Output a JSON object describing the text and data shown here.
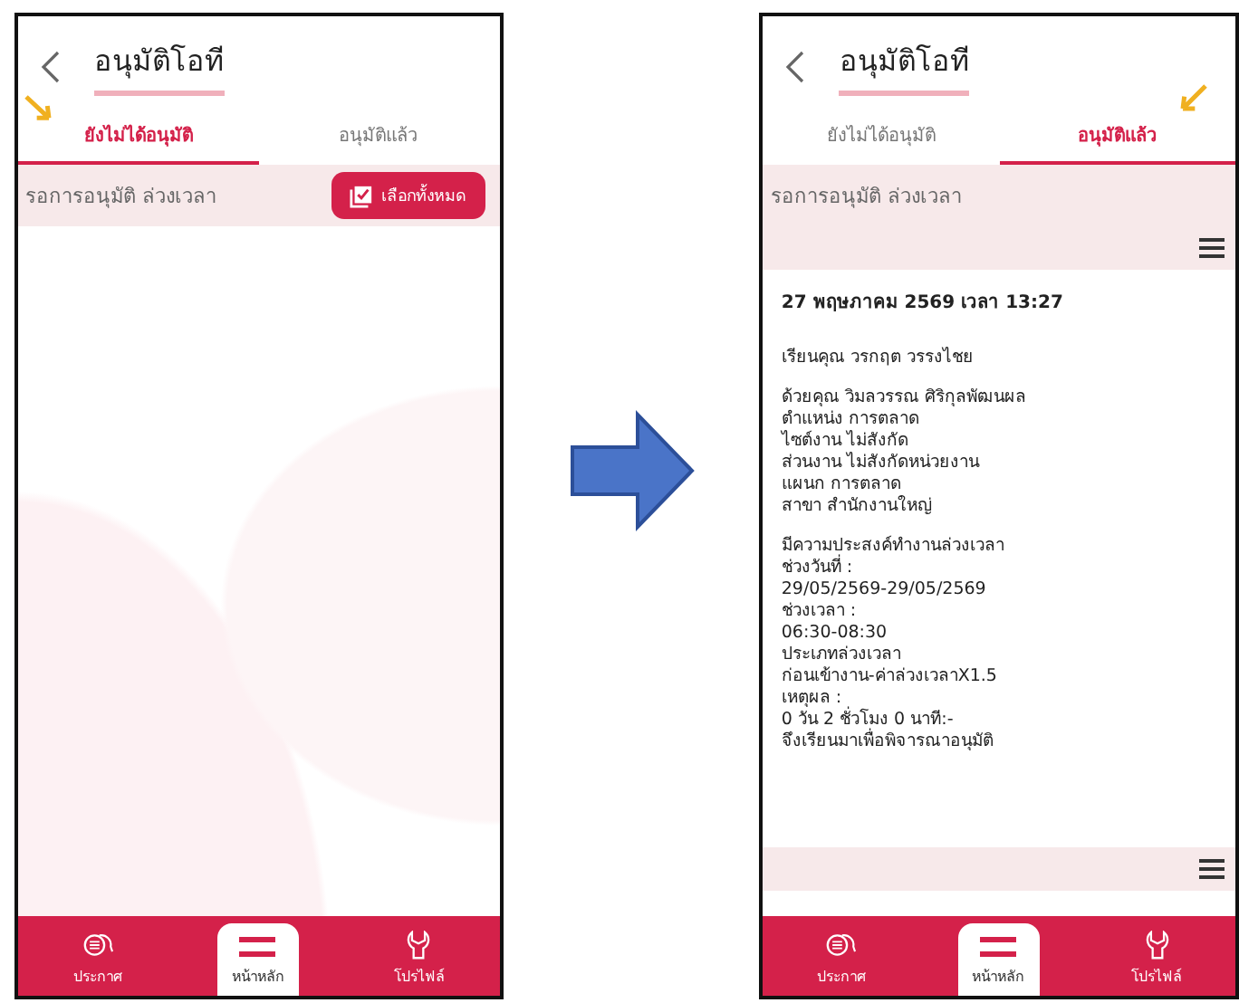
{
  "screens": [
    {
      "title": "อนุมัติโอที",
      "tabs": [
        {
          "label": "ยังไม่ได้อนุมัติ",
          "selected": true,
          "pointed": true
        },
        {
          "label": "อนุมัติแล้ว",
          "selected": false,
          "pointed": false
        }
      ],
      "subheader": "รอการอนุมัติ ล่วงเวลา",
      "select_all_button": "เลือกทั้งหมด",
      "nav": [
        {
          "label": "ประกาศ",
          "kind": "chat",
          "selected": false
        },
        {
          "label": "หน้าหลัก",
          "kind": "home",
          "selected": true
        },
        {
          "label": "โปรไฟล์",
          "kind": "tool",
          "selected": false
        }
      ]
    },
    {
      "title": "อนุมัติโอที",
      "tabs": [
        {
          "label": "ยังไม่ได้อนุมัติ",
          "selected": false,
          "pointed": false
        },
        {
          "label": "อนุมัติแล้ว",
          "selected": true,
          "pointed": true
        }
      ],
      "subheader": "รอการอนุมัติ ล่วงเวลา",
      "message": {
        "date": "27 พฤษภาคม 2569 เวลา 13:27",
        "paragraphs": [
          [
            "เรียนคุณ วรกฤต วรรงไชย"
          ],
          [
            "ด้วยคุณ วิมลวรรณ ศิริกุลพัฒนผล",
            "ตำแหน่ง การตลาด",
            "ไซต์งาน ไม่สังกัด",
            "ส่วนงาน ไม่สังกัดหน่วยงาน",
            "แผนก การตลาด",
            "สาขา สำนักงานใหญ่"
          ],
          [
            "มีความประสงค์ทำงานล่วงเวลา",
            "ช่วงวันที่ :",
            "29/05/2569-29/05/2569",
            "ช่วงเวลา :",
            "06:30-08:30",
            "ประเภทล่วงเวลา",
            "ก่อนเข้างาน-ค่าล่วงเวลาX1.5",
            "เหตุผล :",
            "0 วัน 2 ชั่วโมง 0 นาที:-",
            "จึงเรียนมาเพื่อพิจารณาอนุมัติ"
          ]
        ]
      },
      "nav": [
        {
          "label": "ประกาศ",
          "kind": "chat",
          "selected": false
        },
        {
          "label": "หน้าหลัก",
          "kind": "home",
          "selected": true
        },
        {
          "label": "โปรไฟล์",
          "kind": "tool",
          "selected": false
        }
      ]
    }
  ]
}
